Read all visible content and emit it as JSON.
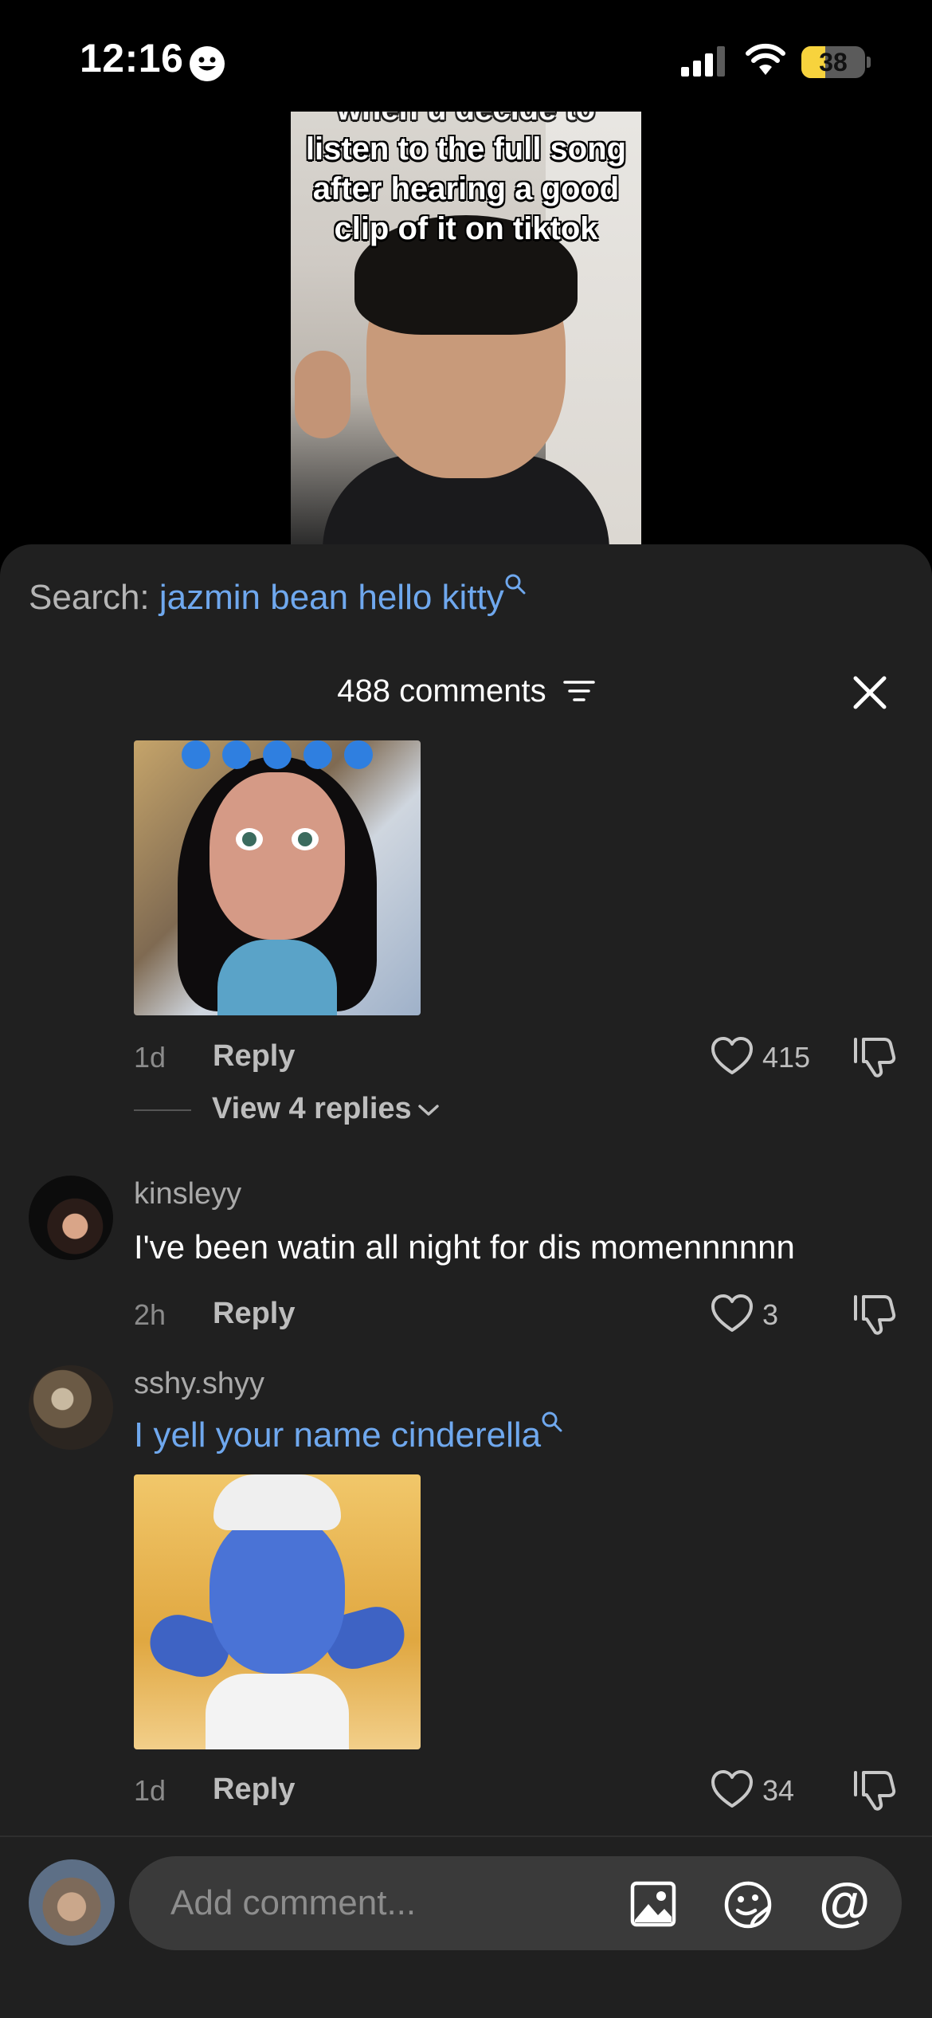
{
  "status_bar": {
    "time": "12:16",
    "battery_percent": "38",
    "battery_level": 0.38
  },
  "video": {
    "caption_top": "when u decide to",
    "caption_main": "listen to the full song\nafter hearing a good\nclip of it on tiktok"
  },
  "search": {
    "prefix": "Search:",
    "term": "jazmin bean hello kitty"
  },
  "comments_header": {
    "count_label": "488 comments"
  },
  "comments": [
    {
      "time_ago": "1d",
      "reply_label": "Reply",
      "likes": "415",
      "view_replies": "View 4 replies"
    },
    {
      "username": "kinsleyy",
      "text": "I've been watin all night for dis momennnnnn",
      "time_ago": "2h",
      "reply_label": "Reply",
      "likes": "3"
    },
    {
      "username": "sshy.shyy",
      "text": "I yell your name cinderella",
      "time_ago": "1d",
      "reply_label": "Reply",
      "likes": "34"
    }
  ],
  "composer": {
    "placeholder": "Add comment..."
  },
  "colors": {
    "link": "#6fa8ee",
    "sheet_bg": "#202020",
    "battery": "#f7d33d"
  },
  "icons": [
    "smiley-icon",
    "signal-icon",
    "wifi-icon",
    "battery-icon",
    "search-icon",
    "sort-icon",
    "close-icon",
    "heart-icon",
    "dislike-icon",
    "chevron-down-icon",
    "image-icon",
    "sticker-icon",
    "mention-icon"
  ]
}
